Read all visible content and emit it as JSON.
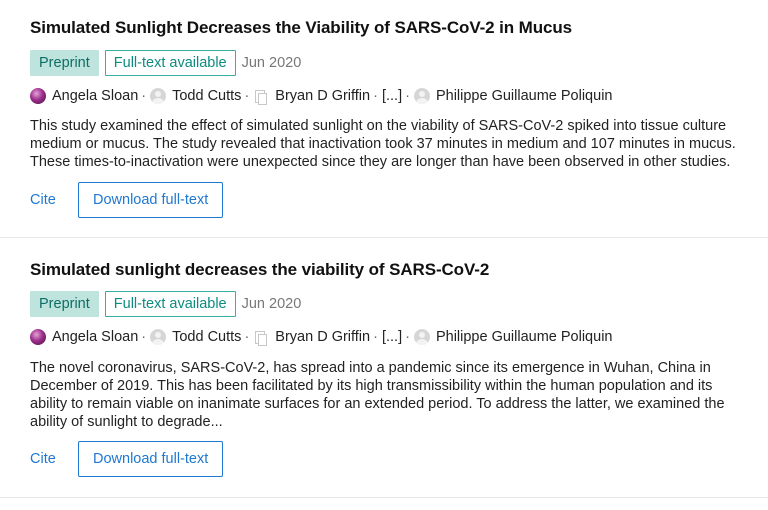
{
  "results": [
    {
      "title": "Simulated Sunlight Decreases the Viability of SARS-CoV-2 in Mucus",
      "badge_type": "Preprint",
      "badge_fulltext": "Full-text available",
      "date": "Jun 2020",
      "authors": [
        "Angela Sloan",
        "Todd Cutts",
        "Bryan D Griffin",
        "[...]",
        "Philippe Guillaume Poliquin"
      ],
      "abstract": "This study examined the effect of simulated sunlight on the viability of SARS-CoV-2 spiked into tissue culture medium or mucus. The study revealed that inactivation took 37 minutes in medium and 107 minutes in mucus. These times-to-inactivation were unexpected since they are longer than have been observed in other studies.",
      "cite_label": "Cite",
      "download_label": "Download full-text"
    },
    {
      "title": "Simulated sunlight decreases the viability of SARS-CoV-2",
      "badge_type": "Preprint",
      "badge_fulltext": "Full-text available",
      "date": "Jun 2020",
      "authors": [
        "Angela Sloan",
        "Todd Cutts",
        "Bryan D Griffin",
        "[...]",
        "Philippe Guillaume Poliquin"
      ],
      "abstract": "The novel coronavirus, SARS-CoV-2, has spread into a pandemic since its emergence in Wuhan, China in December of 2019. This has been facilitated by its high transmissibility within the human population and its ability to remain viable on inanimate surfaces for an extended period. To address the latter, we examined the ability of sunlight to degrade...",
      "cite_label": "Cite",
      "download_label": "Download full-text"
    }
  ],
  "colors": {
    "accent_blue": "#1f78d1",
    "preprint_bg": "#bfe3dd",
    "preprint_text": "#0d6e66",
    "fulltext_border": "#3aaea2",
    "fulltext_text": "#0d8b80"
  },
  "icons": {
    "author_avatar_photo": "avatar-photo",
    "author_avatar_placeholder": "person-placeholder-icon",
    "author_avatar_document": "document-icon"
  }
}
